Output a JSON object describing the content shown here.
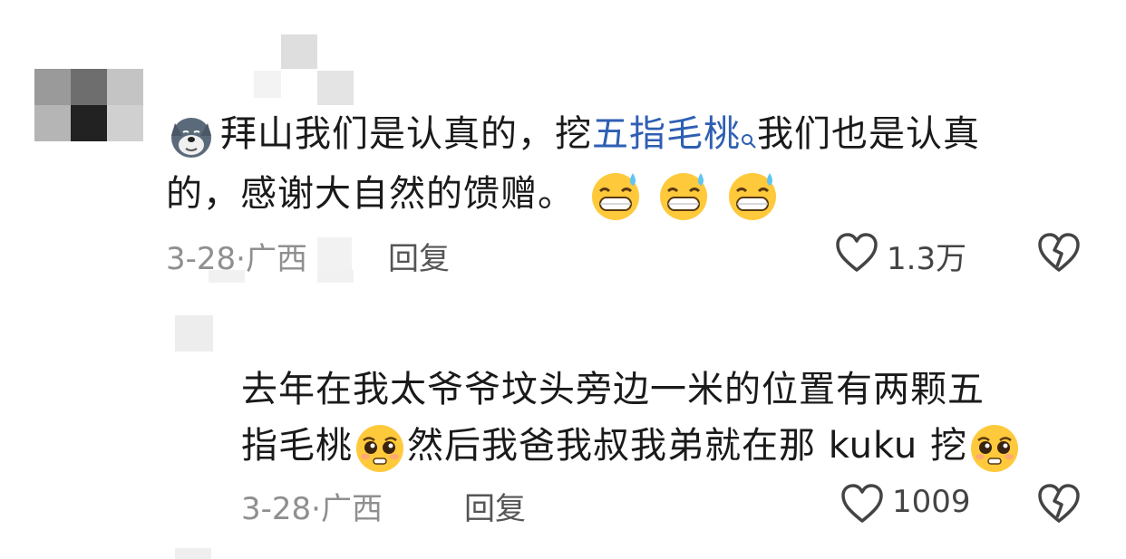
{
  "comment1": {
    "text_before_link": "拜山我们是认真的，挖",
    "link_text": "五指毛桃",
    "text_after_link_line1": "我们也是认真",
    "line2_text": "的，感谢大自然的馈赠。",
    "date": "3-28",
    "location": "广西",
    "reply_label": "回复",
    "like_count": "1.3万"
  },
  "comment2": {
    "line1_text": "去年在我太爷爷坟头旁边一米的位置有两颗五",
    "line2_part1": "指毛桃",
    "line2_part2": "然后我爸我叔我弟就在那 kuku 挖",
    "date": "3-28",
    "location": "广西",
    "reply_label": "回复",
    "like_count": "1009"
  },
  "icons": {
    "avatar_badge": "wolf-face-icon",
    "like": "heart-outline-icon",
    "dislike": "broken-heart-icon",
    "search": "search-icon",
    "emoji_sweat": "grinning-sweat-emoji-icon",
    "emoji_pleading": "pleading-face-emoji-icon"
  },
  "colors": {
    "link": "#2f5fb3",
    "text": "#1a1a1a",
    "meta": "#8f8f8f"
  }
}
